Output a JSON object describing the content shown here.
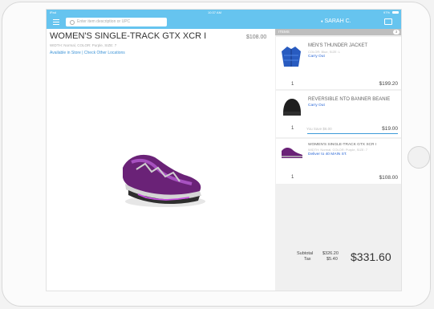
{
  "status_bar": {
    "device": "iPad",
    "time": "10:37 AM",
    "battery": "97%"
  },
  "nav": {
    "search_placeholder": "Enter item description or UPC",
    "user": "SARAH C."
  },
  "product": {
    "title": "WOMEN'S SINGLE-TRACK GTX XCR I",
    "price": "$108.00",
    "details": "WIDTH: Normal, COLOR: Purple, SIZE: 7",
    "links": "Available in Store | Check Other Locations"
  },
  "cart": {
    "header": "ITEMS",
    "count": "3",
    "items": [
      {
        "name": "MEN'S THUNDER JACKET",
        "meta": "COLOR: Blue, SIZE: L",
        "fulfillment": "Carry Out",
        "qty": "1",
        "price": "$199.20"
      },
      {
        "name": "REVERSIBLE NTO BANNER BEANIE",
        "meta": "",
        "fulfillment": "Carry Out",
        "qty": "1",
        "savings": "You Save $6.00",
        "price": "$19.00"
      },
      {
        "name": "WOMEN'S SINGLE-TRACK GTX XCR I",
        "meta": "WIDTH: Normal, COLOR: Purple, SIZE: 7",
        "fulfillment": "Deliver to 40 MAIN ST.",
        "qty": "1",
        "price": "$108.00"
      }
    ],
    "subtotal_label": "Subtotal",
    "subtotal": "$326.20",
    "tax_label": "Tax",
    "tax": "$5.40",
    "total": "$331.60"
  },
  "colors": {
    "accent": "#66c4ef",
    "link": "#2a67d6"
  }
}
